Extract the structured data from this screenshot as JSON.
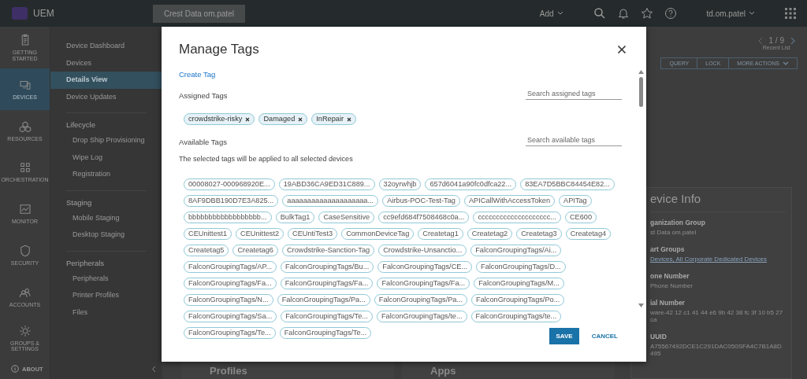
{
  "topbar": {
    "logo": "UEM",
    "org_button": "Crest Data om.patel",
    "add_menu": "Add",
    "user_menu": "td.om.patel"
  },
  "rail": {
    "items": [
      {
        "label": "GETTING STARTED",
        "selected": false
      },
      {
        "label": "DEVICES",
        "selected": true
      },
      {
        "label": "RESOURCES",
        "selected": false
      },
      {
        "label": "ORCHESTRATION",
        "selected": false
      },
      {
        "label": "MONITOR",
        "selected": false
      },
      {
        "label": "SECURITY",
        "selected": false
      },
      {
        "label": "ACCOUNTS",
        "selected": false
      },
      {
        "label": "GROUPS & SETTINGS",
        "selected": false
      }
    ],
    "about": "ABOUT"
  },
  "subnav": {
    "items": [
      {
        "label": "Device Dashboard",
        "selected": false
      },
      {
        "label": "Devices",
        "selected": false
      },
      {
        "label": "Details View",
        "selected": true
      },
      {
        "label": "Device Updates",
        "selected": false
      }
    ],
    "sections": [
      {
        "title": "Lifecycle",
        "items": [
          "Drop Ship Provisioning",
          "Wipe Log",
          "Registration"
        ]
      },
      {
        "title": "Staging",
        "items": [
          "Mobile Staging",
          "Desktop Staging"
        ]
      },
      {
        "title": "Peripherals",
        "items": [
          "Peripherals",
          "Printer Profiles",
          "Files"
        ]
      }
    ]
  },
  "pager": {
    "text": "1 / 9",
    "caption": "Recent List"
  },
  "actions": [
    "QUERY",
    "LOCK",
    "MORE ACTIONS"
  ],
  "device_info": {
    "title": "evice Info",
    "fields": [
      {
        "label": "ganization Group",
        "value": "st Data om.patel",
        "kind": "text"
      },
      {
        "label": "art Groups",
        "value": "Devices, All Corporate Dedicated Devices",
        "kind": "link"
      },
      {
        "label": "one Number",
        "value": "Phone Number",
        "kind": "text"
      },
      {
        "label": "ial Number",
        "value": "ware-42 12 c1 41 44 e6 9b 42 38 fc 3f 10 b5 27 ca",
        "kind": "text"
      },
      {
        "label": "UUID",
        "value": "A75567492DCE1C291DAC050SFA4C7B1A8D495",
        "kind": "text"
      }
    ]
  },
  "bottom_cards": [
    "Profiles",
    "Apps"
  ],
  "modal": {
    "title": "Manage Tags",
    "create_link": "Create Tag",
    "assigned": {
      "label": "Assigned Tags",
      "placeholder": "Search assigned tags",
      "tags": [
        "crowdstrike-risky",
        "Damaged",
        "InRepair"
      ]
    },
    "available": {
      "label": "Available Tags",
      "placeholder": "Search available tags",
      "note": "The selected tags will be applied to all selected devices",
      "tags": [
        "00008027-000968920E...",
        "19ABD36CA9ED31C889...",
        "32oyrwhjb",
        "657d6041a90fc0dfca22...",
        "83EA7D5BBC84454E82...",
        "8AF9DBB190D7E3A825...",
        "aaaaaaaaaaaaaaaaaaaa...",
        "Airbus-POC-Test-Tag",
        "APICallWithAccessToken",
        "APITag",
        "bbbbbbbbbbbbbbbbbb...",
        "BulkTag1",
        "CaseSensitive",
        "cc9efd684f7508468c0a...",
        "cccccccccccccccccccc...",
        "CE600",
        "CEUnittest1",
        "CEUnittest2",
        "CEUntiTest3",
        "CommonDeviceTag",
        "Createtag1",
        "Createtag2",
        "Createtag3",
        "Createtag4",
        "Createtag5",
        "Createtag6",
        "Crowdstrike-Sanction-Tag",
        "Crowdstrike-Unsanctio...",
        "FalconGroupingTags/Ai...",
        "FalconGroupingTags/AP...",
        "FalconGroupingTags/Bu...",
        "FalconGroupingTags/CE...",
        "FalconGroupingTags/D...",
        "FalconGroupingTags/Fa...",
        "FalconGroupingTags/Fa...",
        "FalconGroupingTags/Fa...",
        "FalconGroupingTags/M...",
        "FalconGroupingTags/N...",
        "FalconGroupingTags/Pa...",
        "FalconGroupingTags/Pa...",
        "FalconGroupingTags/Po...",
        "FalconGroupingTags/Sa...",
        "FalconGroupingTags/Te...",
        "FalconGroupingTags/te...",
        "FalconGroupingTags/te...",
        "FalconGroupingTags/Te...",
        "FalconGroupingTags/Te..."
      ]
    },
    "buttons": {
      "save": "SAVE",
      "cancel": "CANCEL"
    }
  }
}
